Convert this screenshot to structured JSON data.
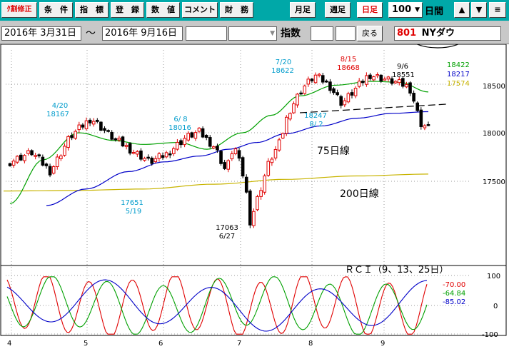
{
  "toolbar": {
    "buttons": [
      "ｸ割修正",
      "条　件",
      "指　標",
      "登　録",
      "数　値",
      "コメント",
      "財　務"
    ],
    "right_buttons": [
      "月足",
      "週足",
      "日足"
    ],
    "count_value": "100",
    "days_label": "日間",
    "up_arrow": "▲",
    "down_arrow": "▼",
    "menu_icon": "≡"
  },
  "infobar": {
    "start_date": "2016年  3月31日",
    "tilde": "〜",
    "end_date": "2016年  9月16日",
    "index_label": "指数",
    "back_label": "戻る",
    "code": "801",
    "name": "NYダウ"
  },
  "chart_data": {
    "type": "candlestick",
    "y_ticks": [
      "18500",
      "18000",
      "17500"
    ],
    "x_ticks": [
      "4",
      "5",
      "6",
      "7",
      "8",
      "9"
    ],
    "price_annotations": [
      {
        "date": "4/20",
        "value": "18167"
      },
      {
        "date": "5/19",
        "value": "17651"
      },
      {
        "date": "6/ 8",
        "value": "18016"
      },
      {
        "date": "6/27",
        "value": "17063"
      },
      {
        "date": "7/20",
        "value": "18622"
      },
      {
        "date": "8/15",
        "value": "18668"
      },
      {
        "date": "8/ 2",
        "value": "18247"
      },
      {
        "date": "9/6",
        "value": "18551"
      }
    ],
    "ma_labels": {
      "ma75": "75日線",
      "ma200": "200日線"
    },
    "ma_values": [
      {
        "value": "18422",
        "color": "#00a000"
      },
      {
        "value": "18217",
        "color": "#0000c8"
      },
      {
        "value": "17574",
        "color": "#c8b400"
      }
    ],
    "rci": {
      "title": "ＲＣＩ（9、13、25日）",
      "y_ticks": [
        "100",
        "0",
        "-100"
      ],
      "values": [
        {
          "value": "-70.00",
          "color": "#e00000"
        },
        {
          "value": "-64.84",
          "color": "#00a000"
        },
        {
          "value": "-85.02",
          "color": "#0000c8"
        }
      ]
    },
    "colors": {
      "up": "#e00000",
      "down": "#000000"
    }
  }
}
